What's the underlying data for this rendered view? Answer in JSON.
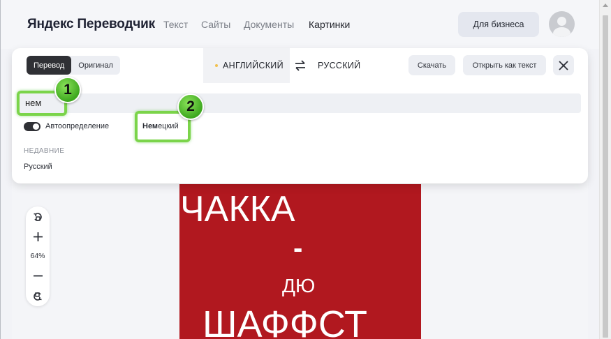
{
  "header": {
    "logo": "Яндекс Переводчик",
    "nav": [
      {
        "label": "Текст"
      },
      {
        "label": "Сайты"
      },
      {
        "label": "Документы"
      },
      {
        "label": "Картинки"
      }
    ],
    "business_button": "Для бизнеса"
  },
  "toolbar": {
    "view_tabs": [
      {
        "label": "Перевод",
        "active": true
      },
      {
        "label": "Оригинал",
        "active": false
      }
    ],
    "source_language": "АНГЛИЙСКИЙ",
    "target_language": "РУССКИЙ",
    "download_label": "Скачать",
    "open_as_text_label": "Открыть как текст"
  },
  "language_picker": {
    "search_value": "нем",
    "autodetect_label": "Автоопределение",
    "autodetect_on": true,
    "result_match": "Нем",
    "result_rest": "ецкий",
    "recent_header": "НЕДАВНИЕ",
    "recent": [
      "Русский"
    ]
  },
  "callouts": [
    "1",
    "2"
  ],
  "zoom": {
    "level": "64%"
  },
  "image_text": [
    "ЧАККА",
    "-",
    "ДЮ",
    "ШАФФСТ"
  ],
  "colors": {
    "accent_dot": "#f2c14e",
    "image_background": "#b1181f",
    "callout_green": "#7bd44a"
  }
}
